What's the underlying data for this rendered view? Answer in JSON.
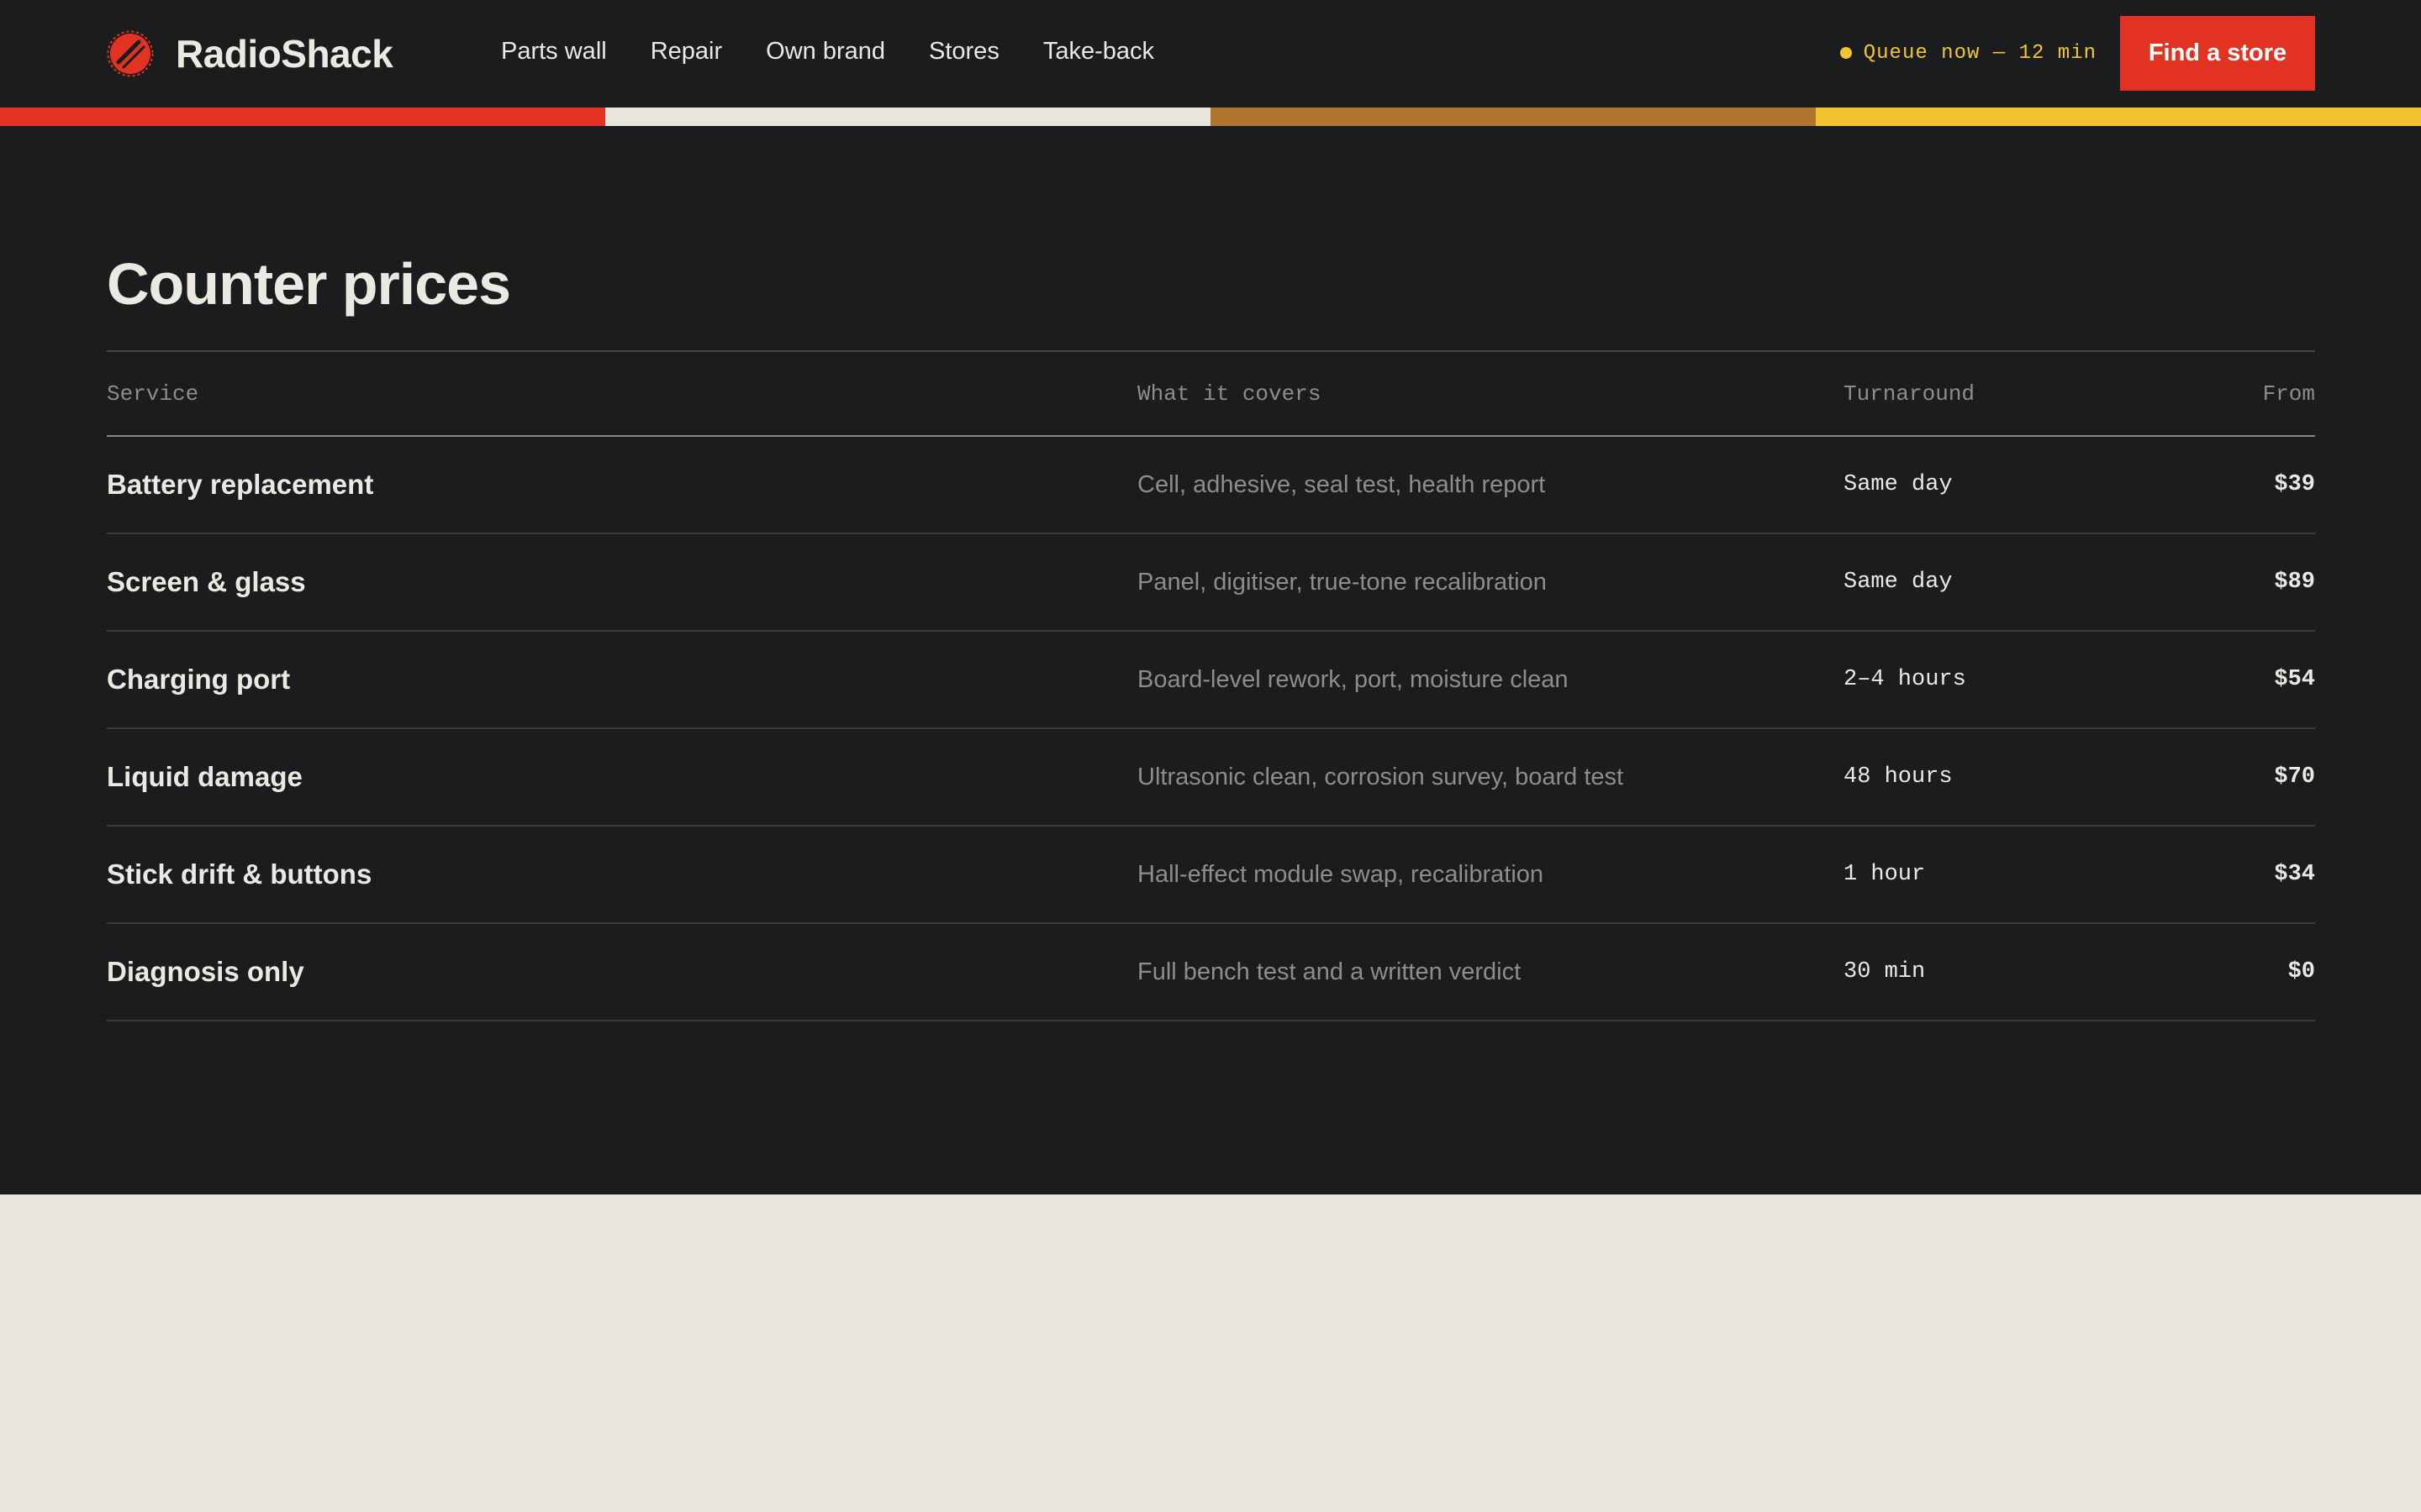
{
  "brand": {
    "name": "RadioShack",
    "accent": "#e23322"
  },
  "nav": {
    "items": [
      {
        "label": "Parts wall"
      },
      {
        "label": "Repair"
      },
      {
        "label": "Own brand"
      },
      {
        "label": "Stores"
      },
      {
        "label": "Take-back"
      }
    ]
  },
  "queue": {
    "text": "Queue now — 12 min",
    "color": "#f2c530"
  },
  "cta": {
    "label": "Find a store"
  },
  "stripes": [
    "#e23322",
    "#e8e5df",
    "#b07330",
    "#f2c530"
  ],
  "pricing": {
    "title": "Counter prices",
    "columns": {
      "service": "Service",
      "covers": "What it covers",
      "turnaround": "Turnaround",
      "from": "From"
    },
    "rows": [
      {
        "service": "Battery replacement",
        "covers": "Cell, adhesive, seal test, health report",
        "turnaround": "Same day",
        "price": "$39"
      },
      {
        "service": "Screen & glass",
        "covers": "Panel, digitiser, true-tone recalibration",
        "turnaround": "Same day",
        "price": "$89"
      },
      {
        "service": "Charging port",
        "covers": "Board-level rework, port, moisture clean",
        "turnaround": "2–4 hours",
        "price": "$54"
      },
      {
        "service": "Liquid damage",
        "covers": "Ultrasonic clean, corrosion survey, board test",
        "turnaround": "48 hours",
        "price": "$70"
      },
      {
        "service": "Stick drift & buttons",
        "covers": "Hall-effect module swap, recalibration",
        "turnaround": "1 hour",
        "price": "$34"
      },
      {
        "service": "Diagnosis only",
        "covers": "Full bench test and a written verdict",
        "turnaround": "30 min",
        "price": "$0"
      }
    ]
  }
}
